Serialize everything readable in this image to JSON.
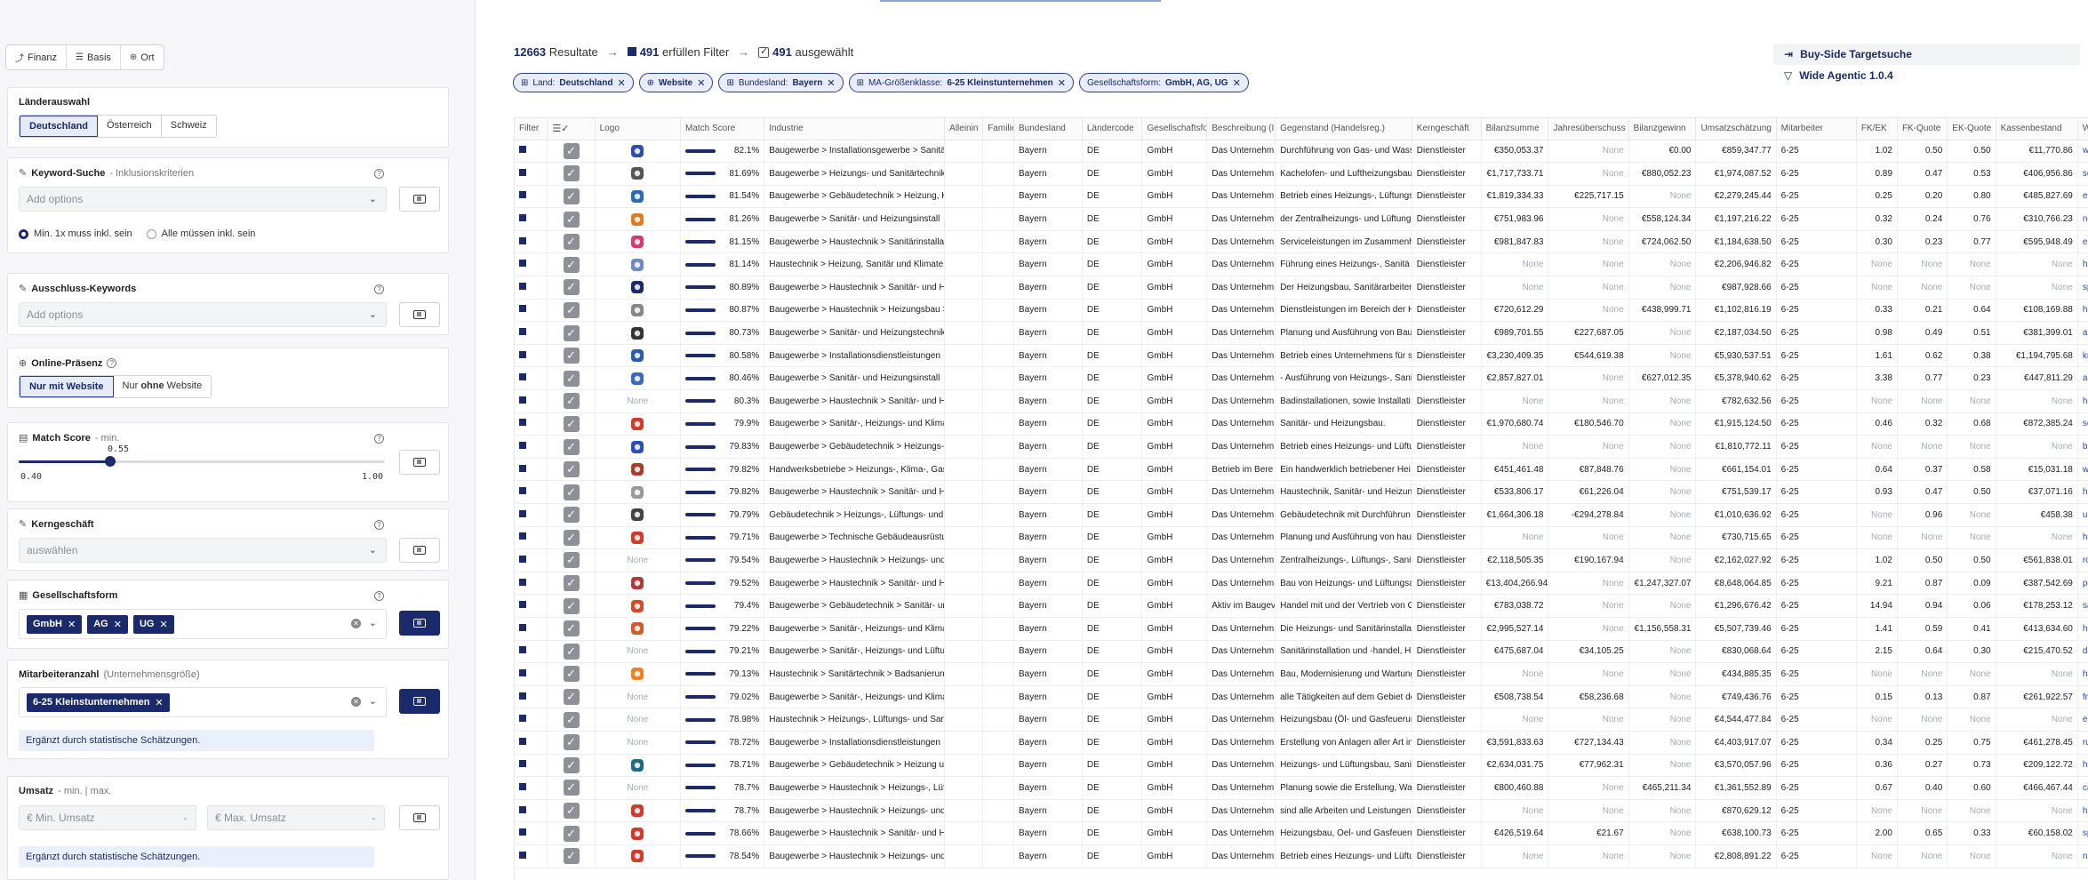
{
  "sidebar": {
    "mode_tabs": [
      {
        "label": "Finanz",
        "icon": "chart-line-icon",
        "glyph": "⤴"
      },
      {
        "label": "Basis",
        "icon": "list-icon",
        "glyph": "☰"
      },
      {
        "label": "Ort",
        "icon": "target-icon",
        "glyph": "⊕"
      }
    ],
    "laender": {
      "title": "Länderauswahl",
      "options": [
        "Deutschland",
        "Österreich",
        "Schweiz"
      ],
      "selected": "Deutschland"
    },
    "keyword": {
      "title": "Keyword-Suche",
      "subtitle": "- Inklusionskriterien",
      "placeholder": "Add options",
      "radio_a": "Min. 1x muss inkl. sein",
      "radio_b": "Alle müssen inkl. sein"
    },
    "ausschluss": {
      "title": "Ausschluss-Keywords",
      "placeholder": "Add options"
    },
    "online": {
      "title": "Online-Präsenz",
      "opt_a_pre": "Nur ",
      "opt_a_bold": "mit",
      "opt_a_post": " Website",
      "opt_b_pre": "Nur ",
      "opt_b_bold": "ohne",
      "opt_b_post": " Website"
    },
    "match": {
      "title": "Match Score",
      "subtitle": "- min.",
      "value": "0.55",
      "min_label": "0.40",
      "max_label": "1.00",
      "fraction": 0.25
    },
    "kern": {
      "title": "Kerngeschäft",
      "placeholder": "auswählen"
    },
    "gesellschaft": {
      "title": "Gesellschaftsform",
      "chips": [
        "GmbH",
        "AG",
        "UG"
      ]
    },
    "mitarbeiter": {
      "title": "Mitarbeiteranzahl",
      "subtitle": "(Unternehmensgröße)",
      "chip": "6-25 Kleinstunternehmen",
      "note": "Ergänzt durch statistische Schätzungen."
    },
    "umsatz": {
      "title": "Umsatz",
      "subtitle": "- min. | max.",
      "min_placeholder": "€ Min. Umsatz",
      "max_placeholder": "€ Max. Umsatz",
      "note": "Ergänzt durch statistische Schätzungen."
    }
  },
  "summary": {
    "results_count": "12663",
    "results_label": "Resultate",
    "filter_count": "491",
    "filter_label": "erfüllen Filter",
    "selected_count": "491",
    "selected_label": "ausgewählt"
  },
  "actions": {
    "buy_side": "Buy-Side Targetsuche",
    "agentic": "Wide Agentic 1.0.4"
  },
  "filters": [
    {
      "key": "Land:",
      "value": "Deutschland",
      "icon": "⊞"
    },
    {
      "key": "",
      "value": "Website",
      "icon": "⊕"
    },
    {
      "key": "Bundesland:",
      "value": "Bayern",
      "icon": "⊞"
    },
    {
      "key": "MA-Größenklasse:",
      "value": "6-25 Kleinstunternehmen",
      "icon": "⊞"
    },
    {
      "key": "Gesellschaftsform:",
      "value": "GmbH, AG, UG",
      "icon": ""
    }
  ],
  "table": {
    "columns": [
      "Filter",
      "",
      "Logo",
      "Match Score",
      "Industrie",
      "Alleinin",
      "Familie",
      "Bundesland",
      "Ländercode",
      "Gesellschaftsfor",
      "Beschreibung (I",
      "Gegenstand (Handelsreg.)",
      "Kerngeschäft",
      "Bilanzsumme",
      "Jahresüberschuss",
      "Bilanzgewinn",
      "Umsatzschätzung",
      "Mitarbeiter",
      "FK/EK",
      "FK-Quote",
      "EK-Quote",
      "Kassenbestand",
      "Web"
    ],
    "rows": [
      {
        "logo": "#2a4fb0",
        "score": "82.1%",
        "ind": "Baugewerbe > Installationsgewerbe > Sanitä",
        "bes": "Das Unternehm",
        "geg": "Durchführung von Gas- und Wass",
        "bil": "€350,053.37",
        "jah": "None",
        "gew": "€0.00",
        "ums": "€859,347.77",
        "fkek": "1.02",
        "fkq": "0.50",
        "ekq": "0.50",
        "kas": "€11,770.86",
        "web": "wink"
      },
      {
        "logo": "#555555",
        "score": "81.69%",
        "ind": "Baugewerbe > Heizungs- und Sanitärtechnik",
        "bes": "Das Unternehm",
        "geg": "Kachelofen- und Luftheizungsbau",
        "bil": "€1,717,733.71",
        "jah": "None",
        "gew": "€880,052.23",
        "ums": "€1,974,087.52",
        "fkek": "0.89",
        "fkq": "0.47",
        "ekq": "0.53",
        "kas": "€406,956.86",
        "web": "schi"
      },
      {
        "logo": "#2a6ab8",
        "score": "81.54%",
        "ind": "Baugewerbe > Gebäudetechnik > Heizung, K",
        "bes": "Das Unternehm",
        "geg": "Betrieb eines Heizungs-, Lüftungs",
        "bil": "€1,819,334.33",
        "jah": "€225,717.15",
        "gew": "None",
        "ums": "€2,279,245.44",
        "fkek": "0.25",
        "fkq": "0.20",
        "ekq": "0.80",
        "kas": "€485,827.69",
        "web": "ebs-"
      },
      {
        "logo": "#e07a1e",
        "score": "81.26%",
        "ind": "Baugewerbe > Sanitär- und Heizungsinstall",
        "bes": "Das Unternehm",
        "geg": "der Zentralheizungs- und Lüftung",
        "bil": "€751,983.96",
        "jah": "None",
        "gew": "€558,124.34",
        "ums": "€1,197,216.22",
        "fkek": "0.32",
        "fkq": "0.24",
        "ekq": "0.76",
        "kas": "€310,766.23",
        "web": "neu"
      },
      {
        "logo": "#d63a6a",
        "score": "81.15%",
        "ind": "Baugewerbe > Haustechnik > Sanitärinstallat",
        "bes": "Das Unternehm",
        "geg": "Serviceleistungen im Zusammenh",
        "bil": "€981,847.83",
        "jah": "None",
        "gew": "€724,062.50",
        "ums": "€1,184,638.50",
        "fkek": "0.30",
        "fkq": "0.23",
        "ekq": "0.77",
        "kas": "€595,948.49",
        "web": "emil"
      },
      {
        "logo": "#6b8cc8",
        "score": "81.14%",
        "ind": "Haustechnik > Heizung, Sanitär und Klimate",
        "bes": "Das Unternehm",
        "geg": "Führung eines Heizungs-, Sanitä",
        "bil": "None",
        "jah": "None",
        "gew": "None",
        "ums": "€2,206,946.82",
        "fkek": "None",
        "fkq": "None",
        "ekq": "None",
        "kas": "None",
        "web": "haus"
      },
      {
        "logo": "#1b2a6b",
        "score": "80.89%",
        "ind": "Baugewerbe > Haustechnik > Sanitär- und He",
        "bes": "Das Unternehm",
        "geg": "Der Heizungsbau, Sanitärarbeiten",
        "bil": "None",
        "jah": "None",
        "gew": "None",
        "ums": "€987,928.66",
        "fkek": "None",
        "fkq": "None",
        "ekq": "None",
        "kas": "None",
        "web": "spin"
      },
      {
        "logo": "#888888",
        "score": "80.87%",
        "ind": "Baugewerbe > Haustechnik > Heizungsbau >",
        "bes": "Das Unternehm",
        "geg": "Dienstleistungen im Bereich der H",
        "bil": "€720,612.29",
        "jah": "None",
        "gew": "€438,999.71",
        "ums": "€1,102,816.19",
        "fkek": "0.33",
        "fkq": "0.21",
        "ekq": "0.64",
        "kas": "€108,169.88",
        "web": "haus"
      },
      {
        "logo": "#333333",
        "score": "80.73%",
        "ind": "Baugewerbe > Sanitär- und Heizungstechnik",
        "bes": "Das Unternehm",
        "geg": "Planung und Ausführung von Bau",
        "bil": "€989,701.55",
        "jah": "€227,687.05",
        "gew": "None",
        "ums": "€2,187,034.50",
        "fkek": "0.98",
        "fkq": "0.49",
        "ekq": "0.51",
        "kas": "€381,399.01",
        "web": "alfo"
      },
      {
        "logo": "#2a5ab0",
        "score": "80.58%",
        "ind": "Baugewerbe > Installationsdienstleistungen",
        "bes": "Das Unternehm",
        "geg": "Betrieb eines Unternehmens für s",
        "bil": "€3,230,409.35",
        "jah": "€544,619.38",
        "gew": "None",
        "ums": "€5,930,537.51",
        "fkek": "1.61",
        "fkq": "0.62",
        "ekq": "0.38",
        "kas": "€1,194,795.68",
        "web": "knor"
      },
      {
        "logo": "#3a6ac0",
        "score": "80.46%",
        "ind": "Baugewerbe > Sanitär- und Heizungsinstall",
        "bes": "Das Unternehm",
        "geg": "- Ausführung von Heizungs-, Sanit",
        "bil": "€2,857,827.01",
        "jah": "None",
        "gew": "€627,012.35",
        "ums": "€5,378,940.62",
        "fkek": "3.38",
        "fkq": "0.77",
        "ekq": "0.23",
        "kas": "€447,811.29",
        "web": "aloi"
      },
      {
        "logo": "",
        "score": "80.3%",
        "ind": "Baugewerbe > Haustechnik > Sanitär- und He",
        "bes": "Das Unternehm",
        "geg": "Badinstallationen, sowie Installati",
        "bil": "None",
        "jah": "None",
        "gew": "None",
        "ums": "€782,632.56",
        "fkek": "None",
        "fkq": "None",
        "ekq": "None",
        "kas": "None",
        "web": "haus"
      },
      {
        "logo": "#d43a2a",
        "score": "79.9%",
        "ind": "Baugewerbe > Sanitär-, Heizungs- und Klima",
        "bes": "Das Unternehm",
        "geg": "Sanitär- und Heizungsbau.",
        "bil": "€1,970,680.74",
        "jah": "€180,546.70",
        "gew": "None",
        "ums": "€1,915,124.50",
        "fkek": "0.46",
        "fkq": "0.32",
        "ekq": "0.68",
        "kas": "€872,385.24",
        "web": "seeb"
      },
      {
        "logo": "#2a4fb0",
        "score": "79.83%",
        "ind": "Baugewerbe > Gebäudetechnik > Heizungs-",
        "bes": "Das Unternehm",
        "geg": "Betrieb eines Heizungs- und Lüftu",
        "bil": "None",
        "jah": "None",
        "gew": "None",
        "ums": "€1,810,772.11",
        "fkek": "None",
        "fkq": "None",
        "ekq": "None",
        "kas": "None",
        "web": "b-g-"
      },
      {
        "logo": "#b03a2a",
        "score": "79.82%",
        "ind": "Handwerksbetriebe > Heizungs-, Klima-, Gas",
        "bes": "Betrieb im Bere",
        "geg": "Ein handwerklich betriebener Hei",
        "bil": "€451,461.48",
        "jah": "€87,848.76",
        "gew": "None",
        "ums": "€661,154.01",
        "fkek": "0.64",
        "fkq": "0.37",
        "ekq": "0.58",
        "kas": "€15,031.18",
        "web": "wag"
      },
      {
        "logo": "#999999",
        "score": "79.82%",
        "ind": "Baugewerbe > Haustechnik > Sanitär- und H",
        "bes": "Das Unternehm",
        "geg": "Haustechnik, Sanitär- und Heizun",
        "bil": "€533,806.17",
        "jah": "€61,226.04",
        "gew": "None",
        "ums": "€751,539.17",
        "fkek": "0.93",
        "fkq": "0.47",
        "ekq": "0.50",
        "kas": "€37,071.16",
        "web": "haus"
      },
      {
        "logo": "#444444",
        "score": "79.79%",
        "ind": "Gebäudetechnik > Heizungs-, Lüftungs- und",
        "bes": "Das Unternehm",
        "geg": "Gebäudetechnik mit Durchführun",
        "bil": "€1,664,306.18",
        "jah": "-€294,278.84",
        "gew": "None",
        "ums": "€1,010,636.92",
        "fkek": "None",
        "fkq": "0.96",
        "ekq": "None",
        "kas": "€458.38",
        "web": "uplu"
      },
      {
        "logo": "#d43a2a",
        "score": "79.71%",
        "ind": "Baugewerbe > Technische Gebäudeausrüstu",
        "bes": "Das Unternehm",
        "geg": "Planung und Ausführung von hau",
        "bil": "None",
        "jah": "None",
        "gew": "None",
        "ums": "€730,715.65",
        "fkek": "None",
        "fkq": "None",
        "ekq": "None",
        "kas": "None",
        "web": "heiz"
      },
      {
        "logo": "",
        "score": "79.54%",
        "ind": "Baugewerbe > Haustechnik > Heizungs- und",
        "bes": "Das Unternehm",
        "geg": "Zentralheizungs-, Lüftungs-, Sanit",
        "bil": "€2,118,505.35",
        "jah": "€190,167.94",
        "gew": "None",
        "ums": "€2,162,027.92",
        "fkek": "1.02",
        "fkq": "0.50",
        "ekq": "0.50",
        "kas": "€561,838.01",
        "web": "rom"
      },
      {
        "logo": "#b03a3a",
        "score": "79.52%",
        "ind": "Baugewerbe > Haustechnik > Sanitär- und He",
        "bes": "Das Unternehm",
        "geg": "Bau von Heizungs- und Lüftungsa",
        "bil": "€13,404,266.94",
        "jah": "None",
        "gew": "€1,247,327.07",
        "ums": "€8,648,064.85",
        "fkek": "9.21",
        "fkq": "0.87",
        "ekq": "0.09",
        "kas": "€387,542.69",
        "web": "posc"
      },
      {
        "logo": "#d44a2a",
        "score": "79.4%",
        "ind": "Baugewerbe > Gebäudetechnik > Sanitär- un",
        "bes": "Aktiv im Baugev",
        "geg": "Handel mit und der Vertrieb von G",
        "bil": "€783,038.72",
        "jah": "None",
        "gew": "None",
        "ums": "€1,296,676.42",
        "fkek": "14.94",
        "fkq": "0.94",
        "ekq": "0.06",
        "kas": "€178,253.12",
        "web": "sani"
      },
      {
        "logo": "#d45a2a",
        "score": "79.22%",
        "ind": "Baugewerbe > Sanitär-, Heizungs- und Klima",
        "bes": "Das Unternehm",
        "geg": "Die Heizungs- und Sanitärinstallat",
        "bil": "€2,995,527.14",
        "jah": "None",
        "gew": "€1,156,558.31",
        "ums": "€5,507,739.46",
        "fkek": "1.41",
        "fkq": "0.59",
        "ekq": "0.41",
        "kas": "€413,634.60",
        "web": "hoch"
      },
      {
        "logo": "",
        "score": "79.21%",
        "ind": "Baugewerbe > Sanitär-, Heizungs- und Lüftu",
        "bes": "Das Unternehm",
        "geg": "Sanitärinstallation und -handel, H",
        "bil": "€475,687.04",
        "jah": "€34,105.25",
        "gew": "None",
        "ums": "€830,068.64",
        "fkek": "2.15",
        "fkq": "0.64",
        "ekq": "0.30",
        "kas": "€215,470.52",
        "web": "din-"
      },
      {
        "logo": "#f08020",
        "score": "79.13%",
        "ind": "Haustechnik > Sanitärtechnik > Badsanierun",
        "bes": "Das Unternehm",
        "geg": "Bau, Modernisierung und Wartung",
        "bil": "None",
        "jah": "None",
        "gew": "None",
        "ums": "€434,885.35",
        "fkek": "None",
        "fkq": "None",
        "ekq": "None",
        "kas": "None",
        "web": "hart"
      },
      {
        "logo": "",
        "score": "79.02%",
        "ind": "Baugewerbe > Sanitär-, Heizungs- und Klima",
        "bes": "Das Unternehm",
        "geg": "alle Tätigkeiten auf dem Gebiet de",
        "bil": "€508,738.54",
        "jah": "€58,236.68",
        "gew": "None",
        "ums": "€749,436.76",
        "fkek": "0.15",
        "fkq": "0.13",
        "ekq": "0.87",
        "kas": "€261,922.57",
        "web": "fritz"
      },
      {
        "logo": "",
        "score": "78.98%",
        "ind": "Haustechnik > Heizungs-, Lüftungs- und Sani",
        "bes": "Das Unternehm",
        "geg": "Heizungsbau (Öl- und Gasfeuerun",
        "bil": "None",
        "jah": "None",
        "gew": "None",
        "ums": "€4,544,477.84",
        "fkek": "None",
        "fkq": "None",
        "ekq": "None",
        "kas": "None",
        "web": "elzir"
      },
      {
        "logo": "",
        "score": "78.72%",
        "ind": "Baugewerbe > Installationsdienstleistungen",
        "bes": "Das Unternehm",
        "geg": "Erstellung von Anlagen aller Art in",
        "bil": "€3,591,833.63",
        "jah": "€727,134.43",
        "gew": "None",
        "ums": "€4,403,917.07",
        "fkek": "0.34",
        "fkq": "0.25",
        "ekq": "0.75",
        "kas": "€461,278.45",
        "web": "rupp"
      },
      {
        "logo": "#1e6a8a",
        "score": "78.71%",
        "ind": "Baugewerbe > Gebäudetechnik > Heizung ur",
        "bes": "Das Unternehm",
        "geg": "Heizungs- und Lüftungsbau, Sanit",
        "bil": "€2,634,031.75",
        "jah": "€77,962.31",
        "gew": "None",
        "ums": "€3,570,057.96",
        "fkek": "0.36",
        "fkq": "0.27",
        "ekq": "0.73",
        "kas": "€209,122.72",
        "web": "heiz"
      },
      {
        "logo": "",
        "score": "78.7%",
        "ind": "Baugewerbe > Haustechnik > Heizungs-, Lüft",
        "bes": "Das Unternehm",
        "geg": "Planung sowie die Erstellung, War",
        "bil": "€800,460.88",
        "jah": "None",
        "gew": "€465,211.34",
        "ums": "€1,361,552.89",
        "fkek": "0.67",
        "fkq": "0.40",
        "ekq": "0.60",
        "kas": "€466,467.44",
        "web": "casp"
      },
      {
        "logo": "#d43a2a",
        "score": "78.7%",
        "ind": "Baugewerbe > Haustechnik > Heizungs- und",
        "bes": "Das Unternehm",
        "geg": "sind alle Arbeiten und Leistungen",
        "bil": "None",
        "jah": "None",
        "gew": "None",
        "ums": "€870,629.12",
        "fkek": "None",
        "fkq": "None",
        "ekq": "None",
        "kas": "None",
        "web": "haus"
      },
      {
        "logo": "#d43a2a",
        "score": "78.66%",
        "ind": "Baugewerbe > Haustechnik > Sanitär- und H",
        "bes": "Das Unternehm",
        "geg": "Heizungsbau, Oel- und Gasfeueru",
        "bil": "€426,519.64",
        "jah": "€21.67",
        "gew": "None",
        "ums": "€638,100.73",
        "fkek": "2.00",
        "fkq": "0.65",
        "ekq": "0.33",
        "kas": "€60,158.02",
        "web": "spol"
      },
      {
        "logo": "#d43a2a",
        "score": "78.54%",
        "ind": "Baugewerbe > Haustechnik > Heizungs- und",
        "bes": "Das Unternehm",
        "geg": "Betrieb eines Heizungs- und Lüftu",
        "bil": "None",
        "jah": "None",
        "gew": "None",
        "ums": "€2,808,891.22",
        "fkek": "None",
        "fkq": "None",
        "ekq": "None",
        "kas": "None",
        "web": "nhs-"
      }
    ],
    "common": {
      "bundesland": "Bayern",
      "land": "DE",
      "form": "GmbH",
      "kern": "Dienstleister",
      "ma": "6-25",
      "none": "None"
    }
  }
}
